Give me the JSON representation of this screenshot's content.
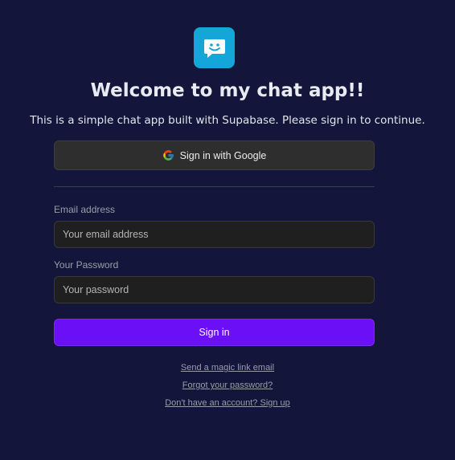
{
  "header": {
    "logo_icon": "chat-bubble-smile-icon",
    "logo_color": "#14a6d8",
    "title": "Welcome to my chat app!!",
    "subtitle": "This is a simple chat app built with Supabase. Please sign in to continue."
  },
  "auth": {
    "google_button_label": "Sign in with Google",
    "google_icon": "google-icon",
    "email_label": "Email address",
    "email_placeholder": "Your email address",
    "email_value": "",
    "password_label": "Your Password",
    "password_placeholder": "Your password",
    "password_value": "",
    "signin_button_label": "Sign in",
    "signin_button_color": "#6b10f6"
  },
  "links": {
    "magic_link": "Send a magic link email",
    "forgot_password": "Forgot your password?",
    "sign_up": "Don't have an account? Sign up"
  }
}
